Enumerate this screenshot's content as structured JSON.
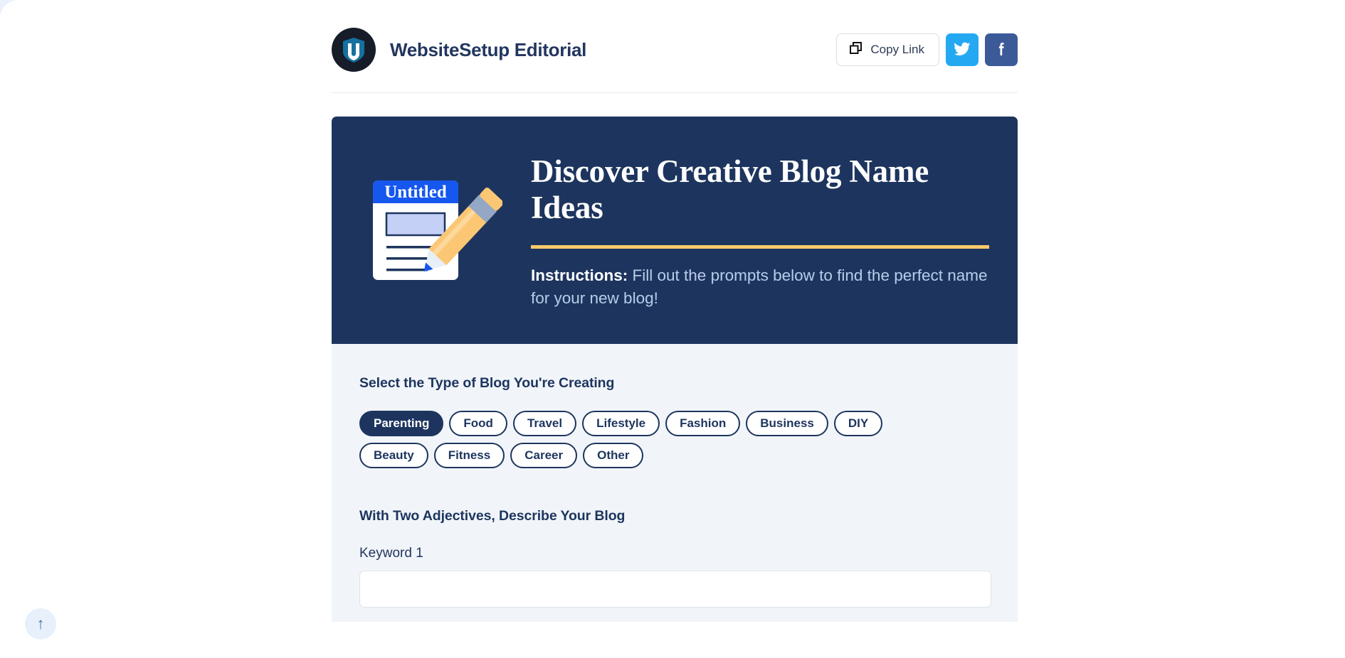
{
  "header": {
    "brand_name": "WebsiteSetup Editorial",
    "avatar_icon": "shield-logo-icon",
    "copy_link_label": "Copy Link",
    "copy_link_icon": "copy-icon",
    "twitter_icon": "twitter-icon",
    "facebook_icon": "facebook-icon"
  },
  "hero": {
    "illustration_icon": "document-and-pencil-icon",
    "document_header_text": "Untitled",
    "title": "Discover Creative Blog Name Ideas",
    "instructions_label": "Instructions:",
    "instructions_text": " Fill out the prompts below to find the perfect name for your new blog!",
    "background_color": "#1d355e",
    "rule_color": "#f8c96b"
  },
  "form": {
    "blog_type_section_title": "Select the Type of Blog You're Creating",
    "blog_types": [
      {
        "label": "Parenting",
        "selected": true
      },
      {
        "label": "Food",
        "selected": false
      },
      {
        "label": "Travel",
        "selected": false
      },
      {
        "label": "Lifestyle",
        "selected": false
      },
      {
        "label": "Fashion",
        "selected": false
      },
      {
        "label": "Business",
        "selected": false
      },
      {
        "label": "DIY",
        "selected": false
      },
      {
        "label": "Beauty",
        "selected": false
      },
      {
        "label": "Fitness",
        "selected": false
      },
      {
        "label": "Career",
        "selected": false
      },
      {
        "label": "Other",
        "selected": false
      }
    ],
    "adjectives_section_title": "With Two Adjectives, Describe Your Blog",
    "keyword1_label": "Keyword 1",
    "keyword1_value": "",
    "keyword1_placeholder": ""
  },
  "scroll_top": {
    "icon": "arrow-up-icon",
    "glyph": "↑"
  },
  "colors": {
    "navy": "#1d355e",
    "gold": "#f8c96b",
    "panel_bg": "#f1f5f9",
    "twitter_blue": "#25a8f2",
    "facebook_blue": "#3c5a98"
  }
}
